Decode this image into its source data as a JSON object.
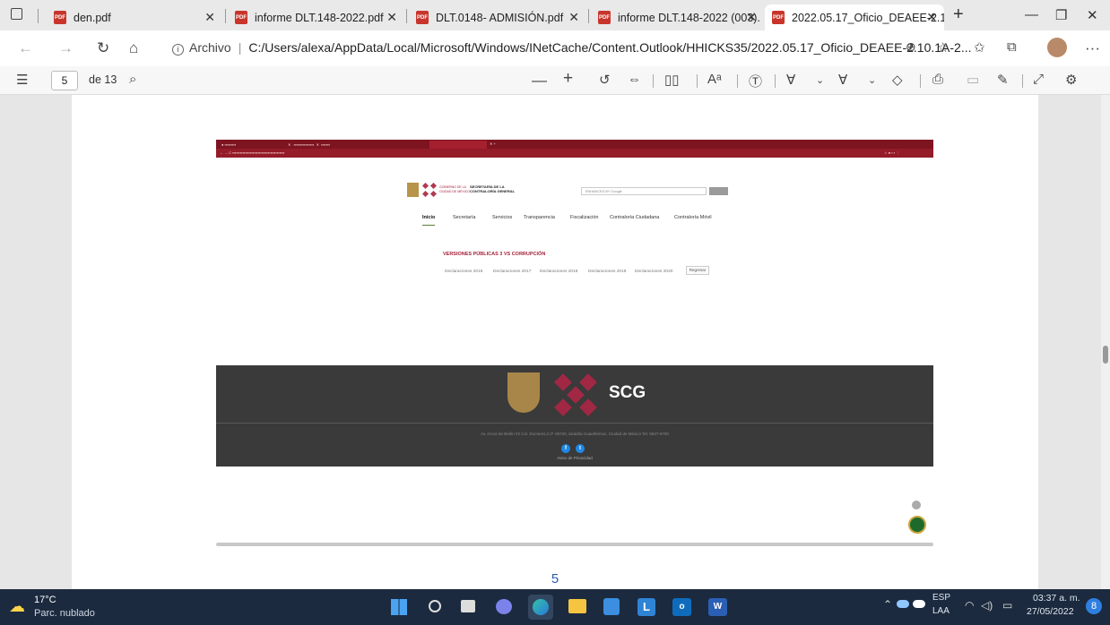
{
  "browser": {
    "tabs": [
      {
        "label": "den.pdf",
        "active": false
      },
      {
        "label": "informe DLT.148-2022.pdf",
        "active": false
      },
      {
        "label": "DLT.0148- ADMISIÓN.pdf",
        "active": false
      },
      {
        "label": "informe DLT.148-2022 (003).",
        "active": false
      },
      {
        "label": "2022.05.17_Oficio_DEAEE-2.1",
        "active": true
      }
    ],
    "address": {
      "label": "Archivo",
      "url": "C:/Users/alexa/AppData/Local/Microsoft/Windows/INetCache/Content.Outlook/HHICKS35/2022.05.17_Oficio_DEAEE-2.10.1A-2..."
    }
  },
  "pdf_toolbar": {
    "page_current": "5",
    "page_total": "de 13"
  },
  "document": {
    "page_number": "5",
    "embedded_site": {
      "header_left_line1": "GOBIERNO DE LA",
      "header_left_line2": "CIUDAD DE MÉXICO",
      "header_right_line1": "SECRETARÍA DE LA",
      "header_right_line2": "CONTRALORÍA GENERAL",
      "search_placeholder": "ENHANCED BY Google",
      "nav": [
        "Inicio",
        "Secretaría",
        "Servicios",
        "Transparencia",
        "Fiscalización",
        "Contraloría Ciudadana",
        "Contraloría Móvil"
      ],
      "section_title": "VERSIONES PÚBLICAS 3 VS CORRUPCIÓN",
      "declarations": [
        "Declaraciones 2016",
        "Declaraciones 2017",
        "Declaraciones 2018",
        "Declaraciones 2019",
        "Declaraciones 2020"
      ],
      "back_button": "Regresar",
      "footer_brand": "SCG",
      "footer_address": "Av. Arcos de Belén #2 Col. Doctores,C.P. 06720, alcaldía Cuauhtémoc, Ciudad de México Tel. 5627-9700",
      "footer_link": "Aviso de Privacidad"
    }
  },
  "taskbar": {
    "weather_temp": "17°C",
    "weather_desc": "Parc. nublado",
    "lang_line1": "ESP",
    "lang_line2": "LAA",
    "time": "03:37 a. m.",
    "date": "27/05/2022",
    "notifications": "8"
  }
}
